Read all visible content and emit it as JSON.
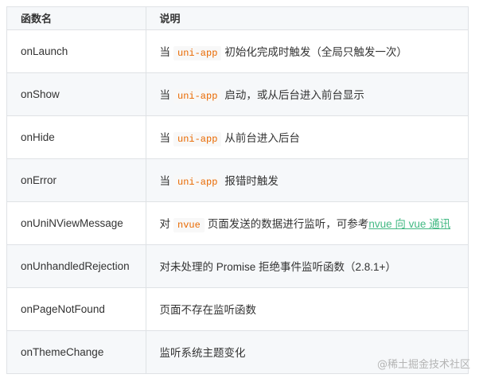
{
  "header": {
    "col1": "函数名",
    "col2": "说明"
  },
  "rows": [
    {
      "name": "onLaunch",
      "pre": "当",
      "code": "uni-app",
      "post": "初始化完成时触发（全局只触发一次）"
    },
    {
      "name": "onShow",
      "pre": "当",
      "code": "uni-app",
      "post": "启动，或从后台进入前台显示"
    },
    {
      "name": "onHide",
      "pre": "当",
      "code": "uni-app",
      "post": "从前台进入后台"
    },
    {
      "name": "onError",
      "pre": "当",
      "code": "uni-app",
      "post": "报错时触发"
    },
    {
      "name": "onUniNViewMessage",
      "pre": "对",
      "code": "nvue",
      "post": "页面发送的数据进行监听，可参考",
      "link": "nvue 向 vue 通讯"
    },
    {
      "name": "onUnhandledRejection",
      "text": "对未处理的 Promise 拒绝事件监听函数（2.8.1+）"
    },
    {
      "name": "onPageNotFound",
      "text": "页面不存在监听函数"
    },
    {
      "name": "onThemeChange",
      "text": "监听系统主题变化"
    }
  ],
  "watermark": "@稀土掘金技术社区",
  "colors": {
    "code": "#e96900",
    "link": "#42b983",
    "border": "#dfe2e5",
    "stripe": "#f6f8fa"
  }
}
